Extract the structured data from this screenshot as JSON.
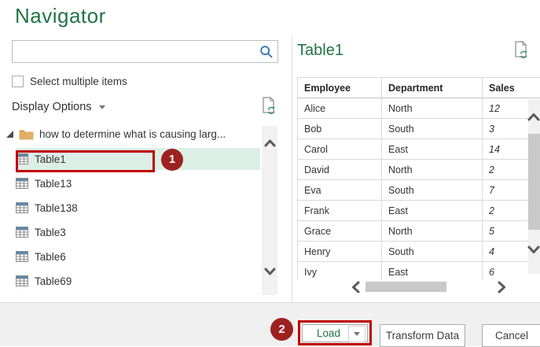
{
  "title": "Navigator",
  "colors": {
    "accent_green": "#217346",
    "annotation_red": "#c00000",
    "badge_red": "#9e2121",
    "selection_mint": "#dcefe6"
  },
  "search": {
    "placeholder": "",
    "value": "",
    "icon": "magnifier-icon"
  },
  "options": {
    "select_multiple_label": "Select multiple items",
    "display_options_label": "Display Options",
    "refresh_icon": "refresh-page-icon"
  },
  "tree": {
    "folder_label": "how to determine what is causing larg...",
    "items": [
      {
        "label": "Table1",
        "selected": true,
        "badge": "1"
      },
      {
        "label": "Table13",
        "selected": false
      },
      {
        "label": "Table138",
        "selected": false
      },
      {
        "label": "Table3",
        "selected": false
      },
      {
        "label": "Table6",
        "selected": false
      },
      {
        "label": "Table69",
        "selected": false
      }
    ]
  },
  "preview": {
    "title": "Table1",
    "columns": [
      "Employee",
      "Department",
      "Sales"
    ],
    "rows": [
      [
        "Alice",
        "North",
        "12"
      ],
      [
        "Bob",
        "South",
        "3"
      ],
      [
        "Carol",
        "East",
        "14"
      ],
      [
        "David",
        "North",
        "2"
      ],
      [
        "Eva",
        "South",
        "7"
      ],
      [
        "Frank",
        "East",
        "2"
      ],
      [
        "Grace",
        "North",
        "5"
      ],
      [
        "Henry",
        "South",
        "4"
      ],
      [
        "Ivy",
        "East",
        "6"
      ]
    ]
  },
  "footer": {
    "load_label": "Load",
    "transform_label": "Transform Data",
    "cancel_label": "Cancel",
    "badge": "2"
  }
}
